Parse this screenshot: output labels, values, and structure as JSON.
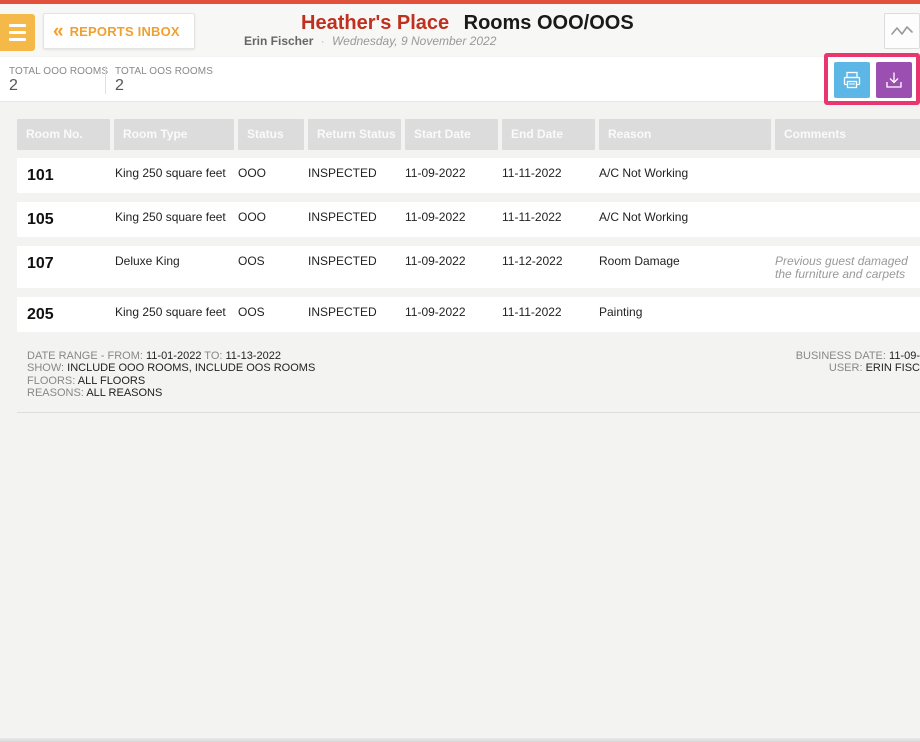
{
  "header": {
    "back_label": "REPORTS INBOX",
    "hotel_name": "Heather's Place",
    "report_title": "Rooms OOO/OOS",
    "user": "Erin Fischer",
    "date": "Wednesday, 9 November 2022",
    "separator": "·"
  },
  "summary": {
    "ooo_label": "TOTAL OOO ROOMS",
    "ooo_value": "2",
    "oos_label": "TOTAL OOS ROOMS",
    "oos_value": "2"
  },
  "actions": {
    "print_icon": "print-icon",
    "download_icon": "download-icon",
    "highlight_color": "#e8376f"
  },
  "table": {
    "headers": [
      "Room No.",
      "Room Type",
      "Status",
      "Return Status",
      "Start Date",
      "End Date",
      "Reason",
      "Comments"
    ],
    "rows": [
      {
        "room": "101",
        "type": "King 250 square feet",
        "status": "OOO",
        "return_status": "INSPECTED",
        "start": "11-09-2022",
        "end": "11-11-2022",
        "reason": "A/C Not Working",
        "comment": ""
      },
      {
        "room": "105",
        "type": "King 250 square feet",
        "status": "OOO",
        "return_status": "INSPECTED",
        "start": "11-09-2022",
        "end": "11-11-2022",
        "reason": "A/C Not Working",
        "comment": ""
      },
      {
        "room": "107",
        "type": "Deluxe King",
        "status": "OOS",
        "return_status": "INSPECTED",
        "start": "11-09-2022",
        "end": "11-12-2022",
        "reason": "Room Damage",
        "comment": "Previous guest damaged the furniture and carpets"
      },
      {
        "room": "205",
        "type": "King 250 square feet",
        "status": "OOS",
        "return_status": "INSPECTED",
        "start": "11-09-2022",
        "end": "11-11-2022",
        "reason": "Painting",
        "comment": ""
      }
    ]
  },
  "footer": {
    "date_range_label": "DATE RANGE - FROM:",
    "date_from": "11-01-2022",
    "to_label": "TO:",
    "date_to": "11-13-2022",
    "show_label": "SHOW:",
    "show_value": "INCLUDE OOO ROOMS, INCLUDE OOS ROOMS",
    "floors_label": "FLOORS:",
    "floors_value": "ALL FLOORS",
    "reasons_label": "REASONS:",
    "reasons_value": "ALL REASONS",
    "business_date_label": "BUSINESS DATE:",
    "business_date_value": "11-09-",
    "user_label": "USER:",
    "user_value": "ERIN FISC"
  },
  "colors": {
    "accent_orange": "#f0a030",
    "hotel_red": "#c0301e",
    "print_blue": "#5db7e6",
    "download_purple": "#9b4fb0"
  }
}
